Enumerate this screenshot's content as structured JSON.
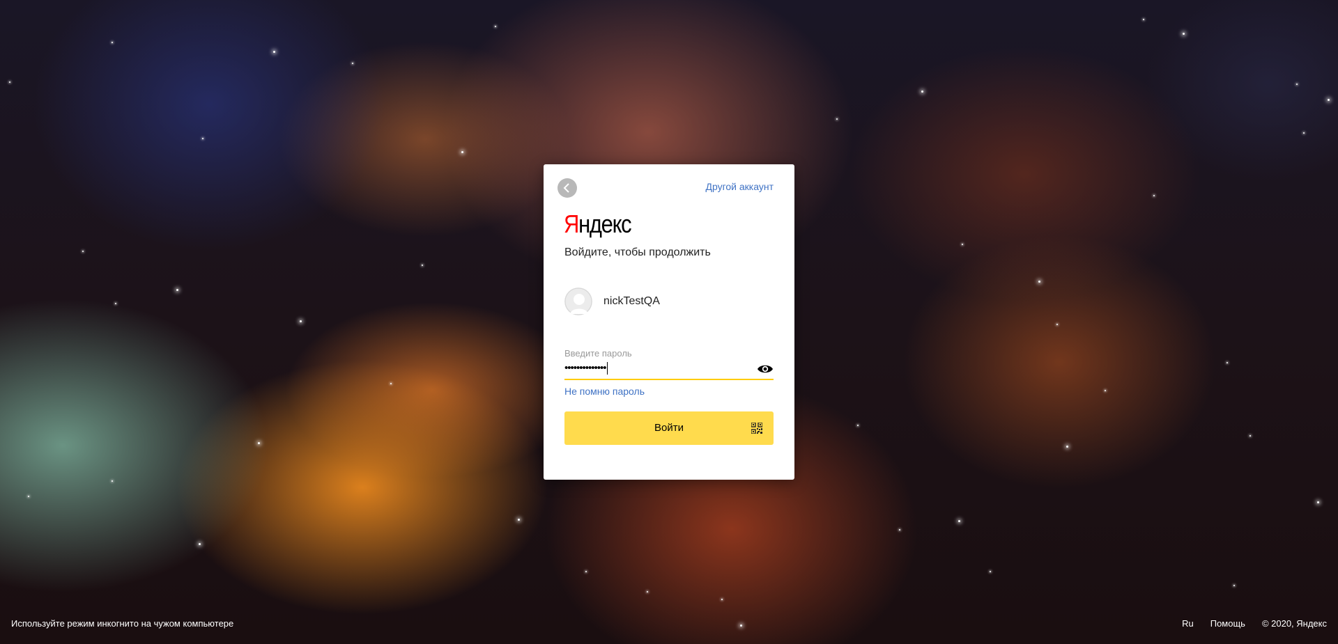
{
  "login": {
    "back_icon": "chevron-left-icon",
    "other_account": "Другой аккаунт",
    "logo": {
      "first_letter": "Я",
      "rest": "ндекс"
    },
    "subtitle": "Войдите, чтобы продолжить",
    "user": {
      "avatar_icon": "user-avatar-icon",
      "name": "nickTestQA"
    },
    "password": {
      "label": "Введите пароль",
      "value": "••••••••••••••",
      "eye_icon": "eye-icon"
    },
    "forgot": "Не помню пароль",
    "submit": {
      "label": "Войти",
      "qr_icon": "qr-code-icon"
    }
  },
  "footer": {
    "incognito_hint": "Используйте режим инкогнито на чужом компьютере",
    "language": "Ru",
    "help": "Помощь",
    "copyright": "© 2020, Яндекс"
  },
  "colors": {
    "accent_yellow": "#ffdb4d",
    "link_blue": "#3f72c4",
    "logo_red": "#ff0000"
  }
}
